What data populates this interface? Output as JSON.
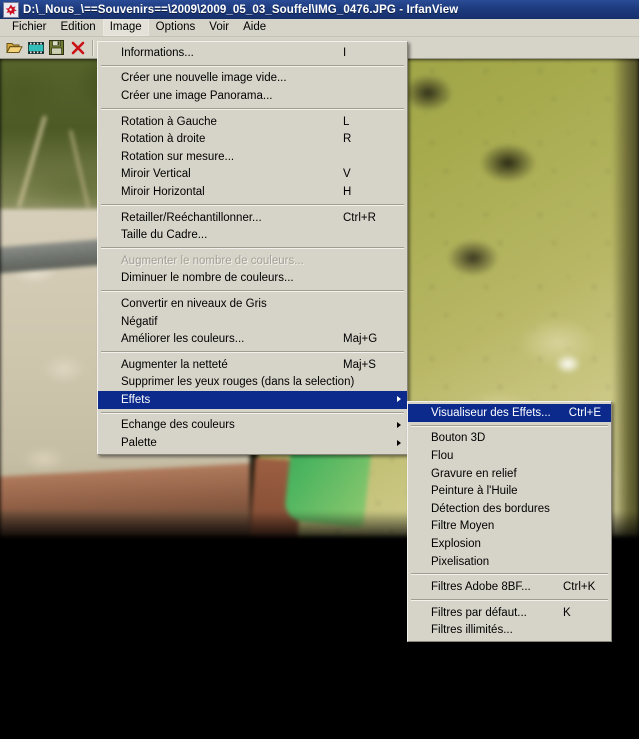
{
  "window": {
    "title": "D:\\_Nous_\\==Souvenirs==\\2009\\2009_05_03_Souffel\\IMG_0476.JPG - IrfanView",
    "icon": "irfanview-logo-icon"
  },
  "menubar": {
    "items": [
      {
        "label": "Fichier",
        "name": "menubar-item-fichier",
        "active": false
      },
      {
        "label": "Edition",
        "name": "menubar-item-edition",
        "active": false
      },
      {
        "label": "Image",
        "name": "menubar-item-image",
        "active": true
      },
      {
        "label": "Options",
        "name": "menubar-item-options",
        "active": false
      },
      {
        "label": "Voir",
        "name": "menubar-item-voir",
        "active": false
      },
      {
        "label": "Aide",
        "name": "menubar-item-aide",
        "active": false
      }
    ]
  },
  "toolbar": {
    "buttons": [
      {
        "name": "open-folder-icon",
        "title": "Ouvrir"
      },
      {
        "name": "thumbnails-filmstrip-icon",
        "title": "Miniatures"
      },
      {
        "name": "save-floppy-icon",
        "title": "Enregistrer"
      },
      {
        "name": "delete-red-x-icon",
        "title": "Supprimer"
      }
    ]
  },
  "image_menu": {
    "title": "Image",
    "items": [
      {
        "type": "item",
        "label": "Informations...",
        "accel": "I",
        "arrow": false,
        "disabled": false,
        "selected": false
      },
      {
        "type": "separator"
      },
      {
        "type": "item",
        "label": "Créer une nouvelle image vide...",
        "accel": "",
        "arrow": false,
        "disabled": false,
        "selected": false
      },
      {
        "type": "item",
        "label": "Créer une image Panorama...",
        "accel": "",
        "arrow": false,
        "disabled": false,
        "selected": false
      },
      {
        "type": "separator"
      },
      {
        "type": "item",
        "label": "Rotation à Gauche",
        "accel": "L",
        "arrow": false,
        "disabled": false,
        "selected": false
      },
      {
        "type": "item",
        "label": "Rotation à droite",
        "accel": "R",
        "arrow": false,
        "disabled": false,
        "selected": false
      },
      {
        "type": "item",
        "label": "Rotation sur mesure...",
        "accel": "",
        "arrow": false,
        "disabled": false,
        "selected": false
      },
      {
        "type": "item",
        "label": "Miroir Vertical",
        "accel": "V",
        "arrow": false,
        "disabled": false,
        "selected": false
      },
      {
        "type": "item",
        "label": "Miroir Horizontal",
        "accel": "H",
        "arrow": false,
        "disabled": false,
        "selected": false
      },
      {
        "type": "separator"
      },
      {
        "type": "item",
        "label": "Retailler/Reéchantillonner...",
        "accel": "Ctrl+R",
        "arrow": false,
        "disabled": false,
        "selected": false
      },
      {
        "type": "item",
        "label": "Taille du Cadre...",
        "accel": "",
        "arrow": false,
        "disabled": false,
        "selected": false
      },
      {
        "type": "separator"
      },
      {
        "type": "item",
        "label": "Augmenter le nombre de couleurs...",
        "accel": "",
        "arrow": false,
        "disabled": true,
        "selected": false
      },
      {
        "type": "item",
        "label": "Diminuer le nombre de couleurs...",
        "accel": "",
        "arrow": false,
        "disabled": false,
        "selected": false
      },
      {
        "type": "separator"
      },
      {
        "type": "item",
        "label": "Convertir en niveaux de Gris",
        "accel": "",
        "arrow": false,
        "disabled": false,
        "selected": false
      },
      {
        "type": "item",
        "label": "Négatif",
        "accel": "",
        "arrow": false,
        "disabled": false,
        "selected": false
      },
      {
        "type": "item",
        "label": "Améliorer les couleurs...",
        "accel": "Maj+G",
        "arrow": false,
        "disabled": false,
        "selected": false
      },
      {
        "type": "separator"
      },
      {
        "type": "item",
        "label": "Augmenter la netteté",
        "accel": "Maj+S",
        "arrow": false,
        "disabled": false,
        "selected": false
      },
      {
        "type": "item",
        "label": "Supprimer les yeux rouges (dans la selection)",
        "accel": "",
        "arrow": false,
        "disabled": false,
        "selected": false
      },
      {
        "type": "item",
        "label": "Effets",
        "accel": "",
        "arrow": true,
        "disabled": false,
        "selected": true
      },
      {
        "type": "separator"
      },
      {
        "type": "item",
        "label": "Echange des couleurs",
        "accel": "",
        "arrow": true,
        "disabled": false,
        "selected": false
      },
      {
        "type": "item",
        "label": "Palette",
        "accel": "",
        "arrow": true,
        "disabled": false,
        "selected": false
      }
    ]
  },
  "effects_submenu": {
    "title": "Effets",
    "items": [
      {
        "type": "item",
        "label": "Visualiseur des Effets...",
        "accel": "Ctrl+E",
        "arrow": false,
        "disabled": false,
        "selected": true
      },
      {
        "type": "separator"
      },
      {
        "type": "item",
        "label": "Bouton 3D",
        "accel": "",
        "arrow": false,
        "disabled": false,
        "selected": false
      },
      {
        "type": "item",
        "label": "Flou",
        "accel": "",
        "arrow": false,
        "disabled": false,
        "selected": false
      },
      {
        "type": "item",
        "label": "Gravure en relief",
        "accel": "",
        "arrow": false,
        "disabled": false,
        "selected": false
      },
      {
        "type": "item",
        "label": "Peinture à l'Huile",
        "accel": "",
        "arrow": false,
        "disabled": false,
        "selected": false
      },
      {
        "type": "item",
        "label": "Détection des bordures",
        "accel": "",
        "arrow": false,
        "disabled": false,
        "selected": false
      },
      {
        "type": "item",
        "label": "Filtre Moyen",
        "accel": "",
        "arrow": false,
        "disabled": false,
        "selected": false
      },
      {
        "type": "item",
        "label": "Explosion",
        "accel": "",
        "arrow": false,
        "disabled": false,
        "selected": false
      },
      {
        "type": "item",
        "label": "Pixelisation",
        "accel": "",
        "arrow": false,
        "disabled": false,
        "selected": false
      },
      {
        "type": "separator"
      },
      {
        "type": "item",
        "label": "Filtres Adobe 8BF...",
        "accel": "Ctrl+K",
        "arrow": false,
        "disabled": false,
        "selected": false
      },
      {
        "type": "separator"
      },
      {
        "type": "item",
        "label": "Filtres par défaut...",
        "accel": "K",
        "arrow": false,
        "disabled": false,
        "selected": false
      },
      {
        "type": "item",
        "label": "Filtres illimités...",
        "accel": "",
        "arrow": false,
        "disabled": false,
        "selected": false
      }
    ]
  },
  "colors": {
    "titlebar": "#1d3b7e",
    "menu_face": "#d6d3c8",
    "menu_highlight": "#0b2a8c",
    "menu_text": "#000000",
    "menu_disabled_text": "#a3a097",
    "canvas_background": "#000000"
  },
  "canvas": {
    "name": "image-viewport",
    "description": "photo IMG_0476.JPG"
  }
}
